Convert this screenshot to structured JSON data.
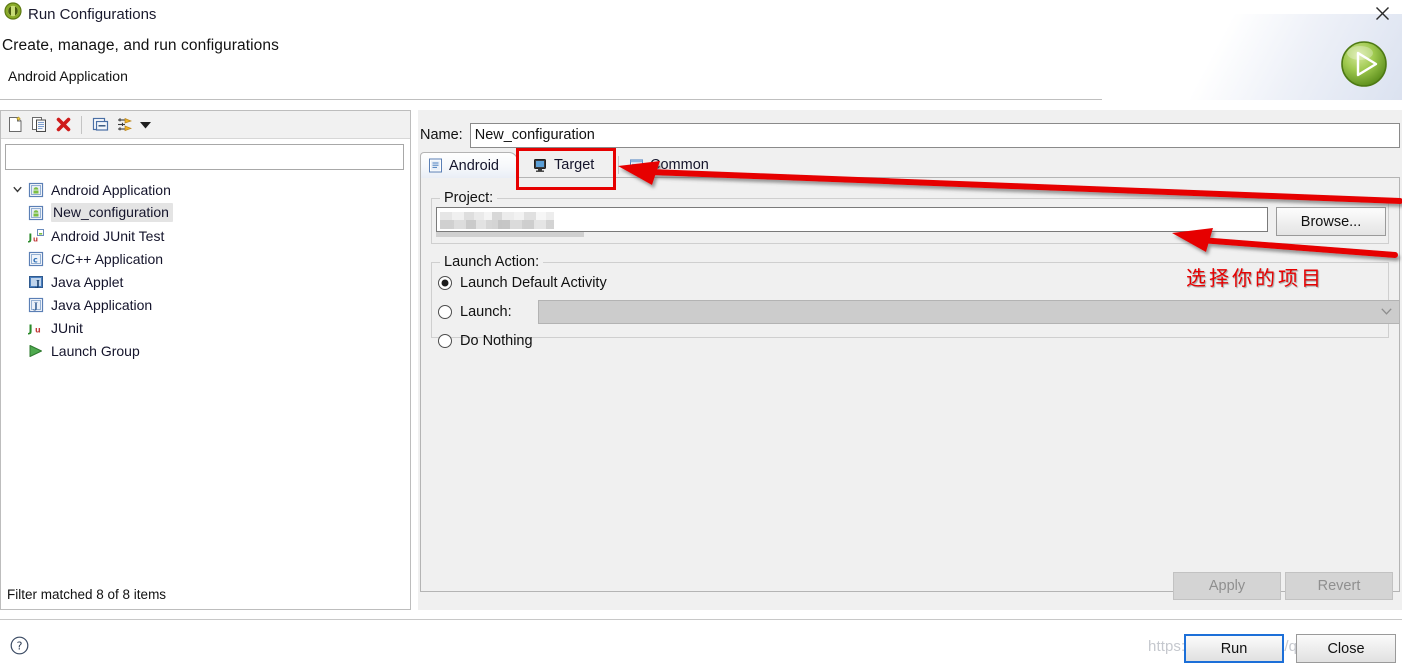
{
  "window": {
    "title": "Run Configurations",
    "icon": "eclipse-launch-icon",
    "close_icon": "close-icon"
  },
  "header": {
    "heading": "Create, manage, and run configurations",
    "subheading": "Android Application",
    "badge_icon": "green-run-play-icon"
  },
  "left_panel": {
    "toolbar": [
      {
        "name": "new-launch-configuration-icon",
        "label": "New launch configuration"
      },
      {
        "name": "duplicate-icon",
        "label": "Duplicate"
      },
      {
        "name": "delete-icon",
        "label": "Delete"
      },
      {
        "name": "collapse-all-icon",
        "label": "Collapse All"
      },
      {
        "name": "filter-icon",
        "label": "Filter launch configurations"
      },
      {
        "name": "chevron-down-icon",
        "label": "View Menu"
      }
    ],
    "filter": {
      "value": "",
      "placeholder": ""
    },
    "tree": [
      {
        "label": "Android Application",
        "icon": "android-application-icon",
        "depth": 0,
        "expanded": true,
        "selected": false
      },
      {
        "label": "New_configuration",
        "icon": "android-application-icon",
        "depth": 1,
        "expanded": false,
        "selected": true
      },
      {
        "label": "Android JUnit Test",
        "icon": "android-junit-icon",
        "depth": 0,
        "expanded": false,
        "selected": false
      },
      {
        "label": "C/C++ Application",
        "icon": "c-cpp-application-icon",
        "depth": 0,
        "expanded": false,
        "selected": false
      },
      {
        "label": "Java Applet",
        "icon": "java-applet-icon",
        "depth": 0,
        "expanded": false,
        "selected": false
      },
      {
        "label": "Java Application",
        "icon": "java-application-icon",
        "depth": 0,
        "expanded": false,
        "selected": false
      },
      {
        "label": "JUnit",
        "icon": "junit-icon",
        "depth": 0,
        "expanded": false,
        "selected": false
      },
      {
        "label": "Launch Group",
        "icon": "launch-group-icon",
        "depth": 0,
        "expanded": false,
        "selected": false
      }
    ],
    "status": "Filter matched 8 of 8 items"
  },
  "right_panel": {
    "name_label": "Name:",
    "name_value": "New_configuration",
    "tabs": [
      {
        "label": "Android",
        "icon": "android-tab-icon",
        "active": true
      },
      {
        "label": "Target",
        "icon": "target-tab-icon",
        "active": false
      },
      {
        "label": "Common",
        "icon": "common-tab-icon",
        "active": false
      }
    ],
    "project_group": {
      "title": "Project:",
      "value": "",
      "redacted": true,
      "browse_label": "Browse..."
    },
    "launch_action": {
      "title": "Launch Action:",
      "options": [
        {
          "label": "Launch Default Activity",
          "selected": true
        },
        {
          "label": "Launch:",
          "selected": false
        },
        {
          "label": "Do Nothing",
          "selected": false
        }
      ],
      "launch_combo_value": "",
      "launch_combo_enabled": false
    },
    "apply_label": "Apply",
    "revert_label": "Revert"
  },
  "footer": {
    "help_icon": "help-question-icon",
    "run_label": "Run",
    "close_label": "Close",
    "watermark": "https://blog.csdn.net/qq_44033320"
  },
  "annotations": {
    "note_text": "选择你的项目",
    "highlight_color": "#e60000",
    "focus_color": "#1c6fd8"
  }
}
